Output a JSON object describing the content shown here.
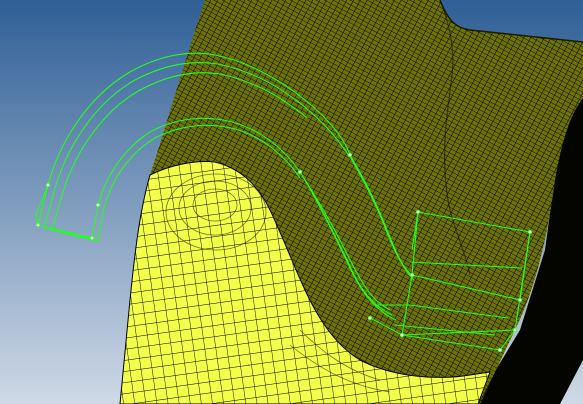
{
  "viewport": {
    "background_top": "#2f5f96",
    "background_bottom": "#cfd9e6"
  },
  "model": {
    "mesh_color": "#f4ff4a",
    "mesh_side_color": "#6f7300",
    "mesh_line_color": "#000000",
    "wire_color": "#22ff22"
  }
}
